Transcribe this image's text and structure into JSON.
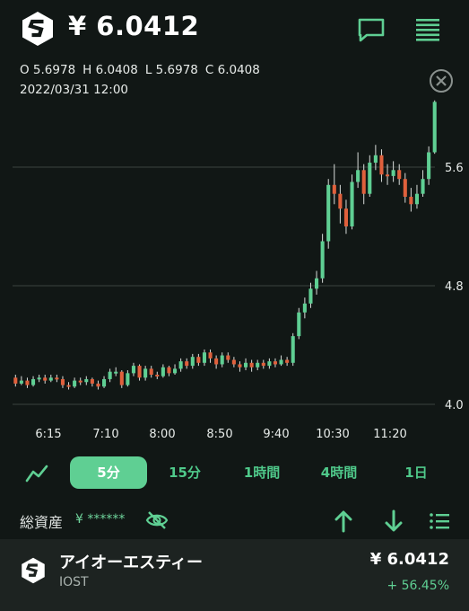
{
  "header": {
    "price": "¥ 6.0412",
    "chat_icon": "chat-bubble-icon",
    "menu_icon": "menu-lines-icon",
    "logo_icon": "iost-logo-icon"
  },
  "ohlc": {
    "open": "O 5.6978",
    "high": "H 6.0408",
    "low": "L 5.6978",
    "close": "C 6.0408",
    "timestamp": "2022/03/31 12:00"
  },
  "chart_data": {
    "type": "candlestick",
    "y_ticks": [
      "5.6",
      "4.8",
      "4.0"
    ],
    "y_tick_values": [
      5.6,
      4.8,
      4.0
    ],
    "x_ticks": [
      "6:15",
      "7:10",
      "8:00",
      "8:50",
      "9:40",
      "10:30",
      "11:20"
    ],
    "ylim": [
      4.0,
      6.1
    ],
    "up_color": "#5fcf93",
    "down_color": "#e0603c",
    "candles": [
      [
        4.18,
        4.14,
        4.2,
        4.12
      ],
      [
        4.14,
        4.16,
        4.19,
        4.13
      ],
      [
        4.16,
        4.13,
        4.18,
        4.11
      ],
      [
        4.13,
        4.17,
        4.19,
        4.12
      ],
      [
        4.17,
        4.18,
        4.2,
        4.15
      ],
      [
        4.18,
        4.16,
        4.2,
        4.14
      ],
      [
        4.16,
        4.18,
        4.2,
        4.15
      ],
      [
        4.18,
        4.17,
        4.2,
        4.15
      ],
      [
        4.17,
        4.13,
        4.19,
        4.11
      ],
      [
        4.13,
        4.12,
        4.15,
        4.1
      ],
      [
        4.12,
        4.16,
        4.18,
        4.11
      ],
      [
        4.16,
        4.15,
        4.18,
        4.13
      ],
      [
        4.15,
        4.17,
        4.19,
        4.13
      ],
      [
        4.17,
        4.14,
        4.18,
        4.12
      ],
      [
        4.14,
        4.12,
        4.16,
        4.1
      ],
      [
        4.12,
        4.17,
        4.19,
        4.11
      ],
      [
        4.17,
        4.22,
        4.24,
        4.15
      ],
      [
        4.22,
        4.22,
        4.25,
        4.19
      ],
      [
        4.22,
        4.13,
        4.23,
        4.11
      ],
      [
        4.13,
        4.21,
        4.23,
        4.12
      ],
      [
        4.21,
        4.26,
        4.28,
        4.19
      ],
      [
        4.26,
        4.18,
        4.27,
        4.16
      ],
      [
        4.18,
        4.24,
        4.26,
        4.16
      ],
      [
        4.24,
        4.2,
        4.26,
        4.18
      ],
      [
        4.2,
        4.19,
        4.22,
        4.17
      ],
      [
        4.19,
        4.25,
        4.27,
        4.18
      ],
      [
        4.25,
        4.21,
        4.26,
        4.19
      ],
      [
        4.21,
        4.24,
        4.27,
        4.2
      ],
      [
        4.24,
        4.29,
        4.31,
        4.22
      ],
      [
        4.29,
        4.26,
        4.31,
        4.24
      ],
      [
        4.26,
        4.32,
        4.34,
        4.24
      ],
      [
        4.32,
        4.28,
        4.34,
        4.26
      ],
      [
        4.28,
        4.35,
        4.37,
        4.26
      ],
      [
        4.35,
        4.31,
        4.37,
        4.28
      ],
      [
        4.31,
        4.27,
        4.33,
        4.24
      ],
      [
        4.27,
        4.33,
        4.35,
        4.25
      ],
      [
        4.33,
        4.3,
        4.35,
        4.28
      ],
      [
        4.3,
        4.27,
        4.32,
        4.25
      ],
      [
        4.27,
        4.25,
        4.29,
        4.22
      ],
      [
        4.25,
        4.28,
        4.31,
        4.23
      ],
      [
        4.28,
        4.25,
        4.3,
        4.22
      ],
      [
        4.25,
        4.28,
        4.3,
        4.23
      ],
      [
        4.28,
        4.26,
        4.3,
        4.24
      ],
      [
        4.26,
        4.29,
        4.31,
        4.24
      ],
      [
        4.29,
        4.27,
        4.31,
        4.25
      ],
      [
        4.27,
        4.3,
        4.33,
        4.26
      ],
      [
        4.3,
        4.28,
        4.32,
        4.26
      ],
      [
        4.28,
        4.46,
        4.48,
        4.26
      ],
      [
        4.46,
        4.62,
        4.65,
        4.44
      ],
      [
        4.62,
        4.68,
        4.72,
        4.58
      ],
      [
        4.68,
        4.78,
        4.82,
        4.65
      ],
      [
        4.78,
        4.85,
        4.9,
        4.74
      ],
      [
        4.85,
        5.1,
        5.15,
        4.82
      ],
      [
        5.1,
        5.48,
        5.52,
        5.05
      ],
      [
        5.48,
        5.42,
        5.62,
        5.35
      ],
      [
        5.42,
        5.32,
        5.48,
        5.22
      ],
      [
        5.32,
        5.2,
        5.38,
        5.15
      ],
      [
        5.2,
        5.5,
        5.55,
        5.18
      ],
      [
        5.5,
        5.58,
        5.7,
        5.46
      ],
      [
        5.58,
        5.42,
        5.62,
        5.35
      ],
      [
        5.42,
        5.63,
        5.68,
        5.4
      ],
      [
        5.63,
        5.68,
        5.75,
        5.58
      ],
      [
        5.68,
        5.55,
        5.72,
        5.5
      ],
      [
        5.55,
        5.54,
        5.62,
        5.48
      ],
      [
        5.54,
        5.58,
        5.64,
        5.5
      ],
      [
        5.58,
        5.52,
        5.62,
        5.48
      ],
      [
        5.52,
        5.4,
        5.56,
        5.36
      ],
      [
        5.4,
        5.35,
        5.46,
        5.3
      ],
      [
        5.35,
        5.42,
        5.48,
        5.32
      ],
      [
        5.42,
        5.52,
        5.58,
        5.4
      ],
      [
        5.52,
        5.7,
        5.74,
        5.48
      ],
      [
        5.7,
        6.04,
        6.05,
        5.69
      ]
    ]
  },
  "intervals": {
    "line_icon": "line-chart-icon",
    "items": [
      "5分",
      "15分",
      "1時間",
      "4時間",
      "1日"
    ],
    "active_index": 0
  },
  "assets": {
    "label": "総資産",
    "value": "¥ ******",
    "eye_icon": "eye-hidden-icon",
    "up_icon": "arrow-up-icon",
    "down_icon": "arrow-down-icon",
    "list_icon": "list-icon"
  },
  "coin": {
    "name": "アイオーエスティー",
    "symbol": "IOST",
    "price": "¥ 6.0412",
    "change": "+ 56.45%"
  }
}
